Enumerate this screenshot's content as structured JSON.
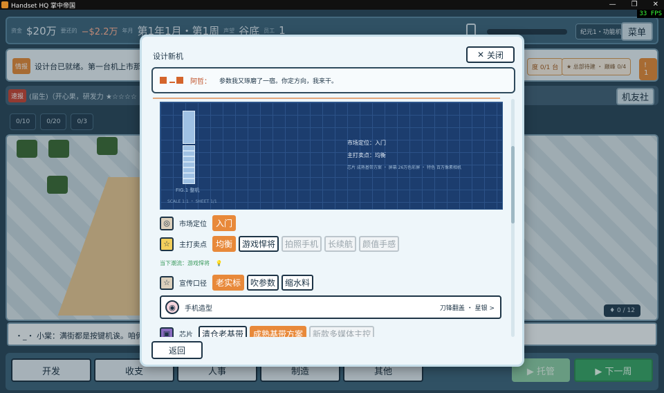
{
  "window": {
    "title": "Handset HQ 掌中帝国",
    "fps": "33 FPS",
    "minimize": "—",
    "restore": "❐",
    "close": "✕"
  },
  "topbar": {
    "cash_label": "资金",
    "cash": "$20万",
    "debt_label": "要还的",
    "debt": "−$2.2万",
    "date_label": "年月",
    "date": "第1年1月・第1周",
    "fame_label": "声望",
    "fame": "谷底",
    "staff_label": "员工",
    "staff": "1",
    "era": "纪元1・功能机",
    "menu": "菜单"
  },
  "news": {
    "tag": "情报",
    "message": "设计台已就绪。第一台机上市那",
    "chip_a": "度 0/1 台",
    "chip_b": "★ 总部待建 ・ 巅峰 0/4",
    "chip_c": "! 1"
  },
  "bulletin": {
    "tag": "速报",
    "text": "(届生)（开心果，研发力 ★☆☆☆☆",
    "club": "机友社"
  },
  "stats": [
    "0/10",
    "0/20",
    "0/3"
  ],
  "world": {
    "counter": "♦ 0 / 12"
  },
  "dialog_line": "・_・  小棠：满街都是按键机诶。咱俩",
  "nav": {
    "develop": "开发",
    "acquire": "收支",
    "hr": "人事",
    "manufacture": "制造",
    "other": "其他",
    "auto": "▶ 托管",
    "next_week": "▶ 下一周"
  },
  "modal": {
    "title": "设计新机",
    "close": "关闭",
    "speaker": "阿哲：",
    "speech": "参数我又琢磨了一宿。你定方向，我来干。",
    "blueprint": {
      "fig": "FIG.1 整机",
      "scale": "SCALE 1:1   ・   SHEET 1/1",
      "market_line": "市场定位：入门",
      "selling_line": "主打卖点：均衡",
      "spec_line": "芯片 成熟基带方案 ・ 屏幕 26万色彩屏 ・ 特色 百万像素相机"
    },
    "market": {
      "label": "市场定位",
      "options": [
        "入门"
      ]
    },
    "selling": {
      "label": "主打卖点",
      "options": [
        "均衡",
        "游戏悍将",
        "拍照手机",
        "长续航",
        "颜值手感"
      ]
    },
    "trend": "当下潮流：游戏悍将",
    "slogan": {
      "label": "宣传口径",
      "options": [
        "老实标",
        "吹参数",
        "缩水料"
      ]
    },
    "model": {
      "label": "手机造型",
      "value": "刀锋翻盖 ・ 星银  >"
    },
    "chip": {
      "label": "芯片",
      "options": [
        "清仓老基带",
        "成熟基带方案",
        "新款多媒体主控"
      ]
    },
    "back": "返回"
  }
}
